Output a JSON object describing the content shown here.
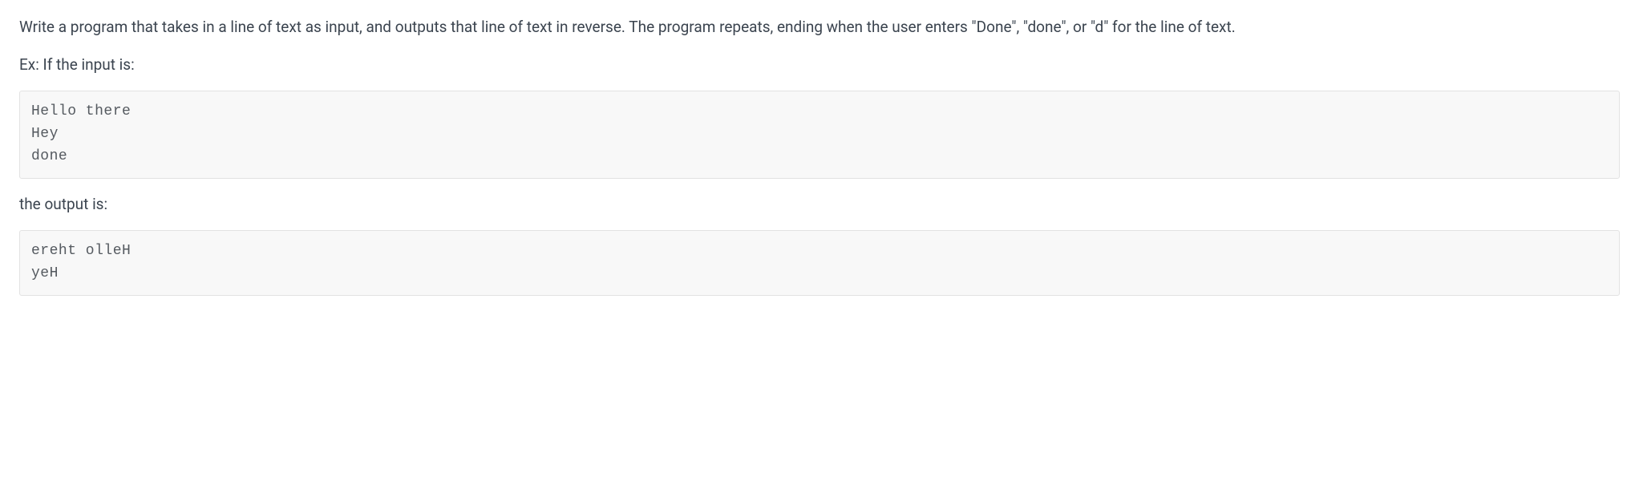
{
  "problem": {
    "description": "Write a program that takes in a line of text as input, and outputs that line of text in reverse. The program repeats, ending when the user enters \"Done\", \"done\", or \"d\" for the line of text.",
    "example_intro": "Ex: If the input is:",
    "input_block": "Hello there\nHey\ndone",
    "output_intro": "the output is:",
    "output_block": "ereht olleH\nyeH"
  }
}
